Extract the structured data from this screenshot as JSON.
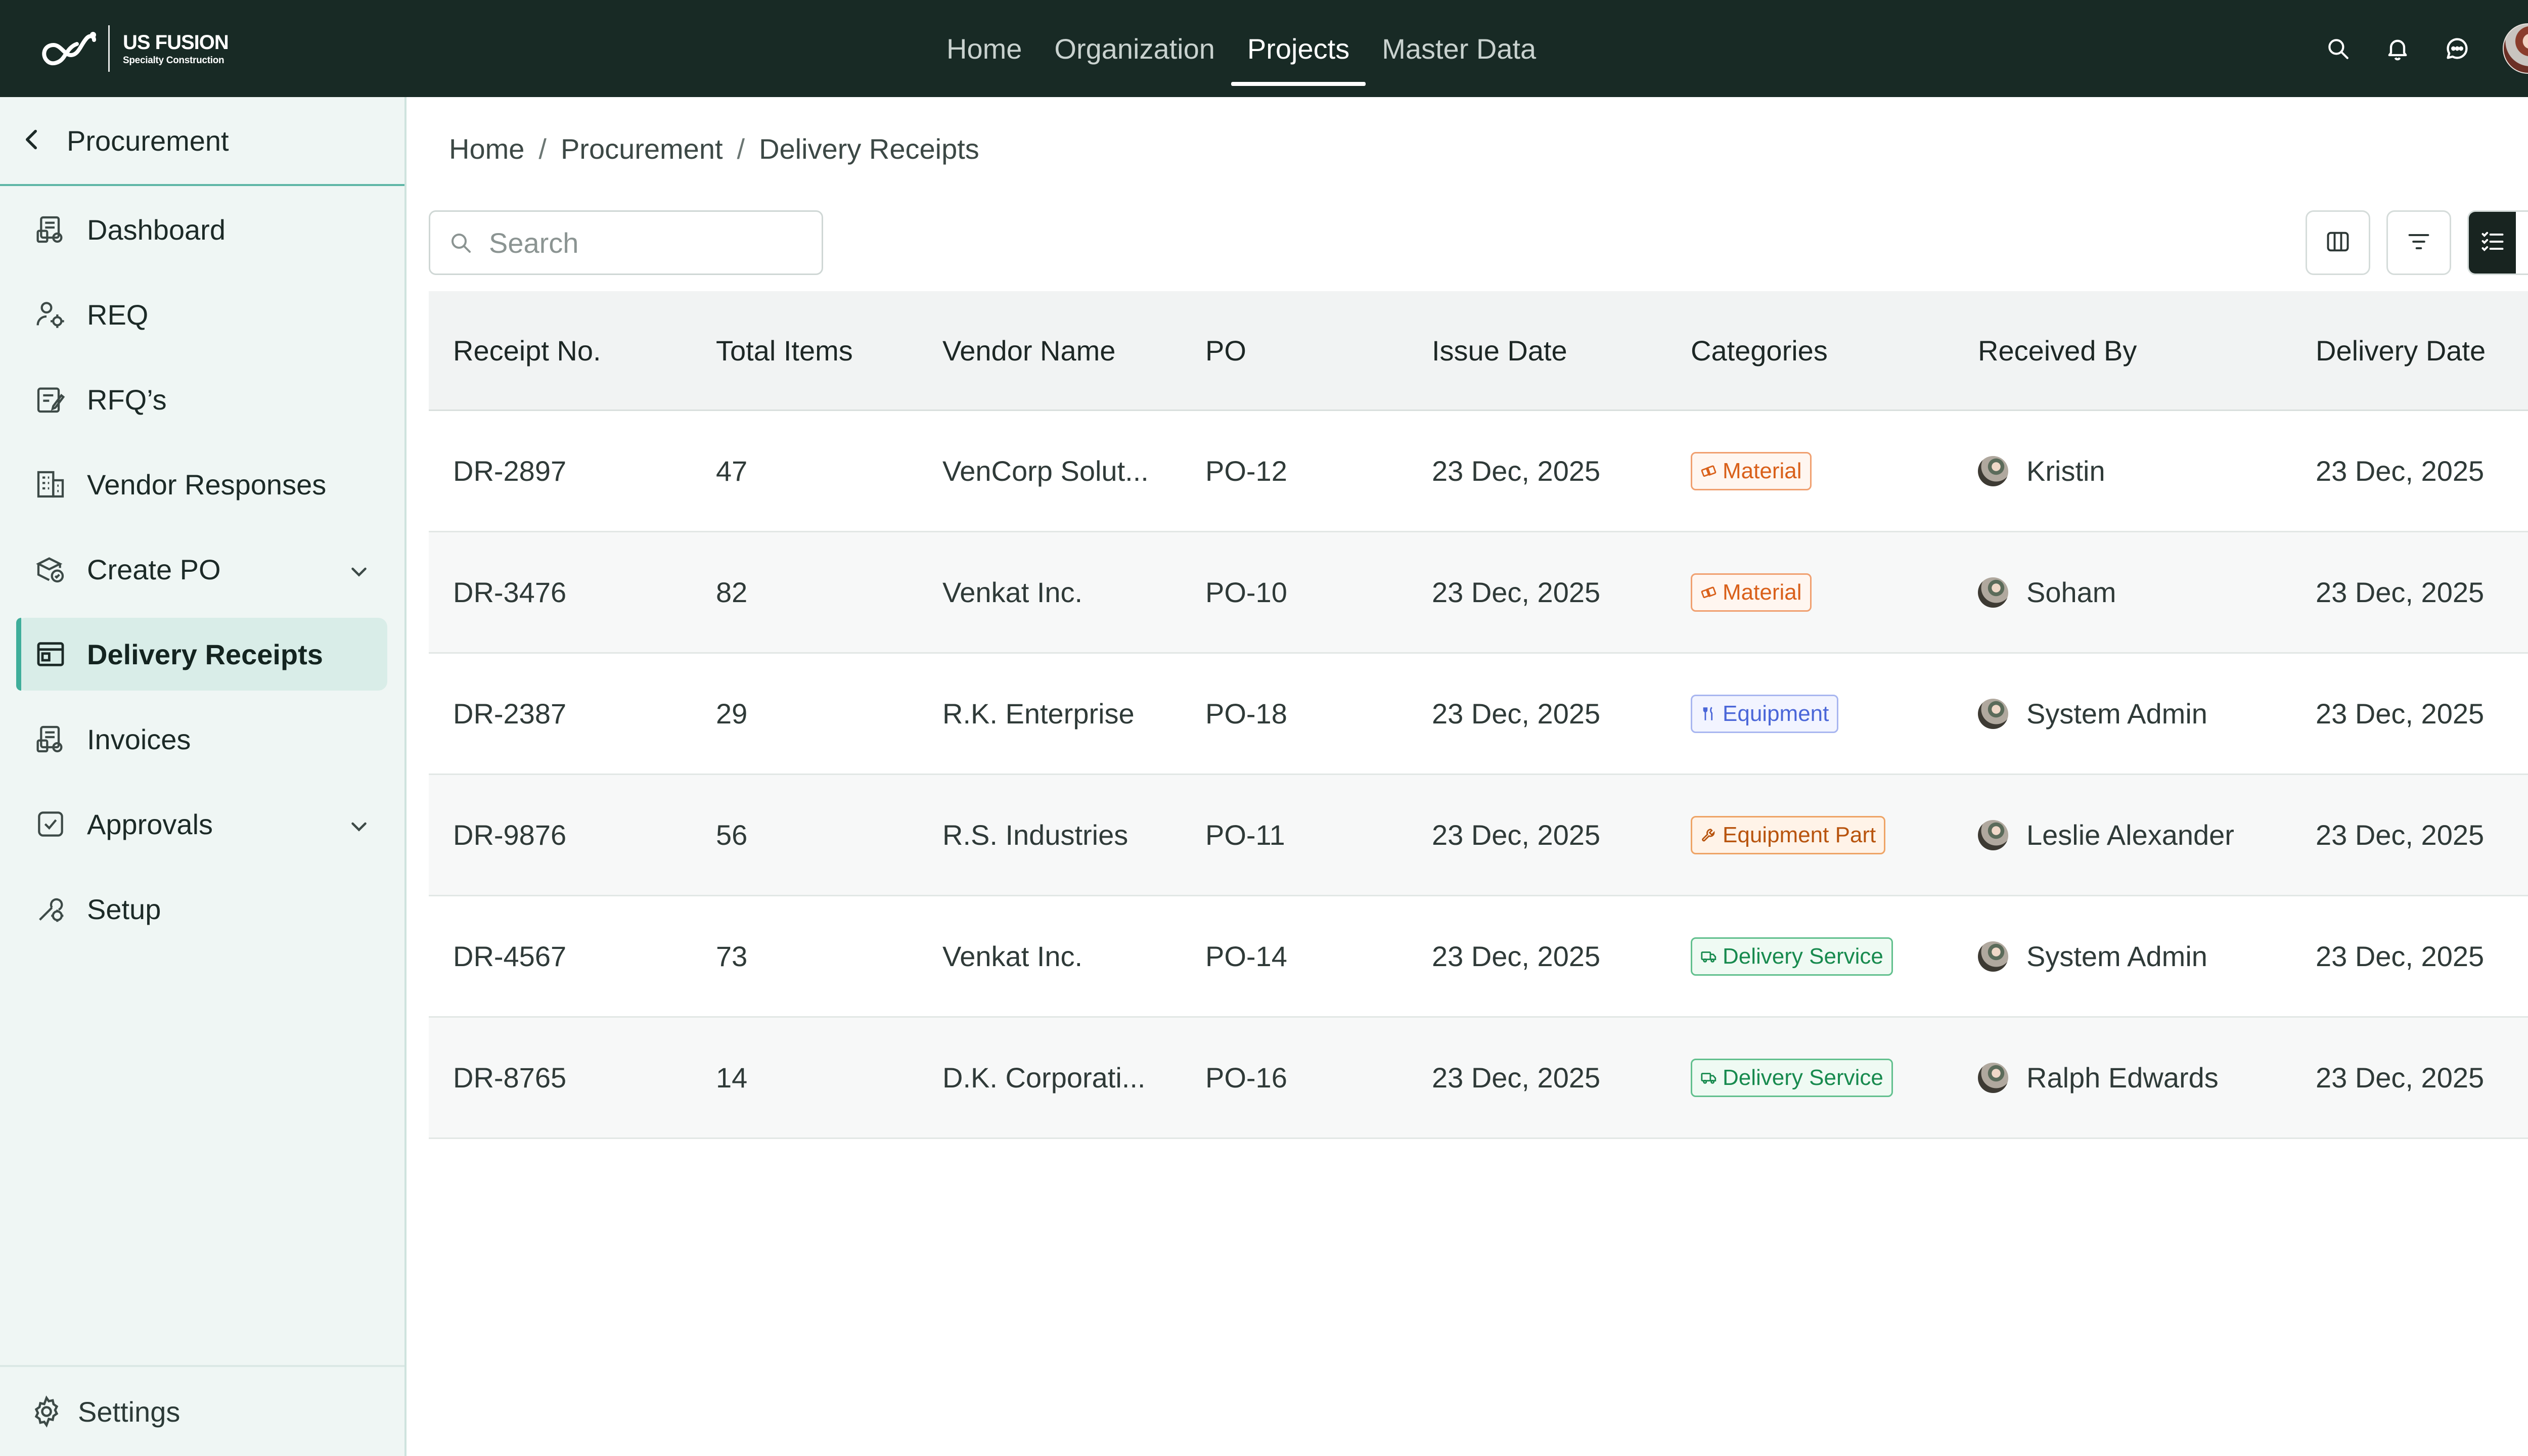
{
  "brand": {
    "name": "US FUSION",
    "tagline": "Specialty Construction"
  },
  "nav": {
    "items": [
      {
        "label": "Home",
        "active": false
      },
      {
        "label": "Organization",
        "active": false
      },
      {
        "label": "Projects",
        "active": true
      },
      {
        "label": "Master Data",
        "active": false
      }
    ]
  },
  "header_icons": [
    "search-icon",
    "bell-icon",
    "chat-icon",
    "user-avatar"
  ],
  "sidebar": {
    "back_label": "Procurement",
    "items": [
      {
        "label": "Dashboard",
        "icon": "dashboard-icon"
      },
      {
        "label": "REQ",
        "icon": "requisition-icon"
      },
      {
        "label": "RFQ’s",
        "icon": "rfq-icon"
      },
      {
        "label": "Vendor Responses",
        "icon": "building-icon"
      },
      {
        "label": "Create PO",
        "icon": "create-po-icon",
        "expandable": true
      },
      {
        "label": "Delivery Receipts",
        "icon": "receipt-icon",
        "active": true
      },
      {
        "label": "Invoices",
        "icon": "invoice-icon"
      },
      {
        "label": "Approvals",
        "icon": "approval-icon",
        "expandable": true
      },
      {
        "label": "Setup",
        "icon": "setup-icon"
      }
    ],
    "settings_label": "Settings"
  },
  "breadcrumb": [
    "Home",
    "Procurement",
    "Delivery Receipts"
  ],
  "search": {
    "placeholder": "Search",
    "value": ""
  },
  "table": {
    "columns": [
      "Receipt No.",
      "Total Items",
      "Vendor Name",
      "PO",
      "Issue Date",
      "Categories",
      "Received By",
      "Delivery Date"
    ],
    "rows": [
      {
        "receipt": "DR-2897",
        "items": "47",
        "vendor": "VenCorp Solut...",
        "po": "PO-12",
        "issue": "23 Dec, 2025",
        "category": "Material",
        "received_by": "Kristin",
        "delivery": "23 Dec, 2025"
      },
      {
        "receipt": "DR-3476",
        "items": "82",
        "vendor": "Venkat Inc.",
        "po": "PO-10",
        "issue": "23 Dec, 2025",
        "category": "Material",
        "received_by": "Soham",
        "delivery": "23 Dec, 2025"
      },
      {
        "receipt": "DR-2387",
        "items": "29",
        "vendor": "R.K. Enterprise",
        "po": "PO-18",
        "issue": "23 Dec, 2025",
        "category": "Equipment",
        "received_by": "System Admin",
        "delivery": "23 Dec, 2025"
      },
      {
        "receipt": "DR-9876",
        "items": "56",
        "vendor": "R.S. Industries",
        "po": "PO-11",
        "issue": "23 Dec, 2025",
        "category": "Equipment Part",
        "received_by": "Leslie Alexander",
        "delivery": "23 Dec, 2025"
      },
      {
        "receipt": "DR-4567",
        "items": "73",
        "vendor": "Venkat Inc.",
        "po": "PO-14",
        "issue": "23 Dec, 2025",
        "category": "Delivery Service",
        "received_by": "System Admin",
        "delivery": "23 Dec, 2025"
      },
      {
        "receipt": "DR-8765",
        "items": "14",
        "vendor": "D.K. Corporati...",
        "po": "PO-16",
        "issue": "23 Dec, 2025",
        "category": "Delivery Service",
        "received_by": "Ralph Edwards",
        "delivery": "23 Dec, 2025"
      }
    ]
  },
  "colors": {
    "topbar": "#182a25",
    "sidebar_bg": "#eff6f4",
    "accent": "#3fae9a",
    "material": "#d9601a",
    "equipment": "#4a66d8",
    "equipment_part": "#b8540e",
    "delivery_service": "#178a4e"
  }
}
